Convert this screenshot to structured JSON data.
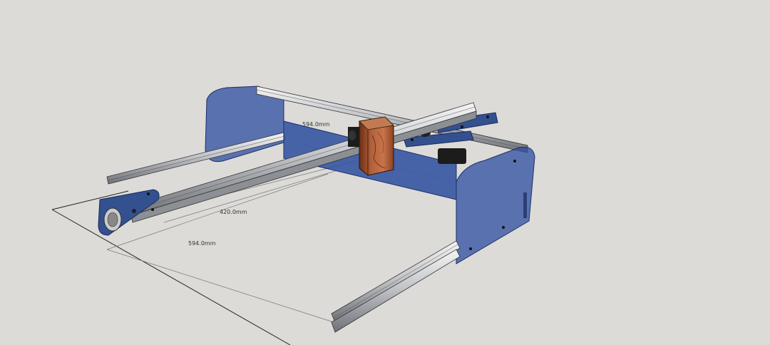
{
  "scene": {
    "dimensions": {
      "width_label": "420.0mm",
      "length_label": "594.0mm",
      "hidden_label": "594.0mm"
    },
    "colors": {
      "background": "#dcdbd8",
      "panel_fill": "#2d4ea0",
      "rail": "#c9cbcf",
      "wood": "#a3502c",
      "plate": "#33508f"
    }
  }
}
